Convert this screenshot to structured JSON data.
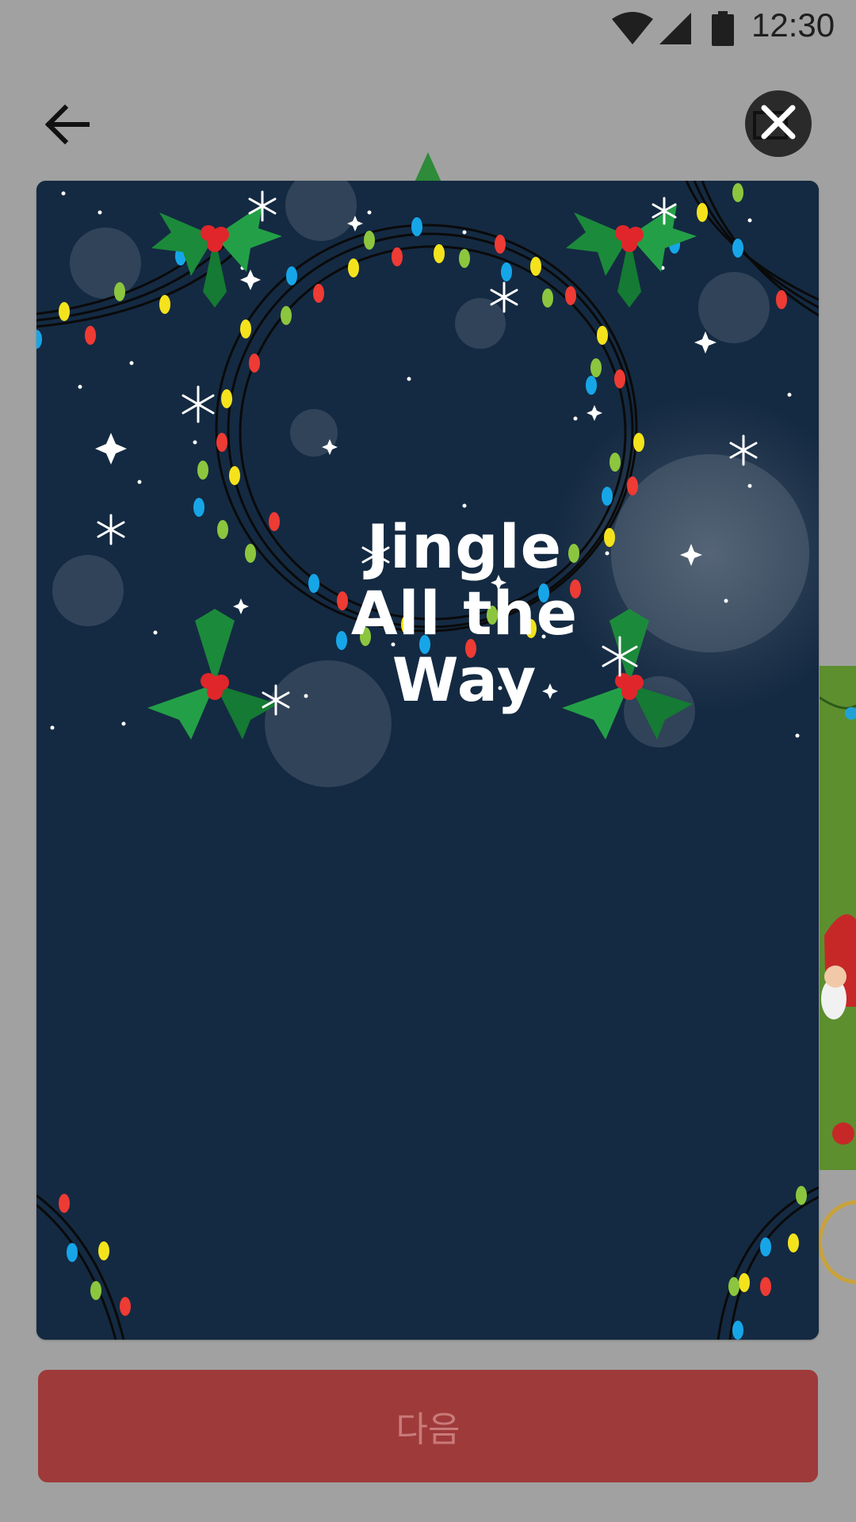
{
  "status_bar": {
    "time": "12:30",
    "icons": [
      "wifi-icon",
      "cellular-signal-icon",
      "battery-icon"
    ]
  },
  "top_bar": {
    "back_icon": "arrow-left-icon",
    "close_icon": "close-icon"
  },
  "card": {
    "title": "Jingle\nAll the\nWay",
    "background_color": "#142a42",
    "decoration": [
      "holly-icon",
      "christmas-lights",
      "snowflake-icon",
      "sparkle-icon"
    ]
  },
  "next_button": {
    "label": "다음",
    "color": "#9f3a3a"
  }
}
